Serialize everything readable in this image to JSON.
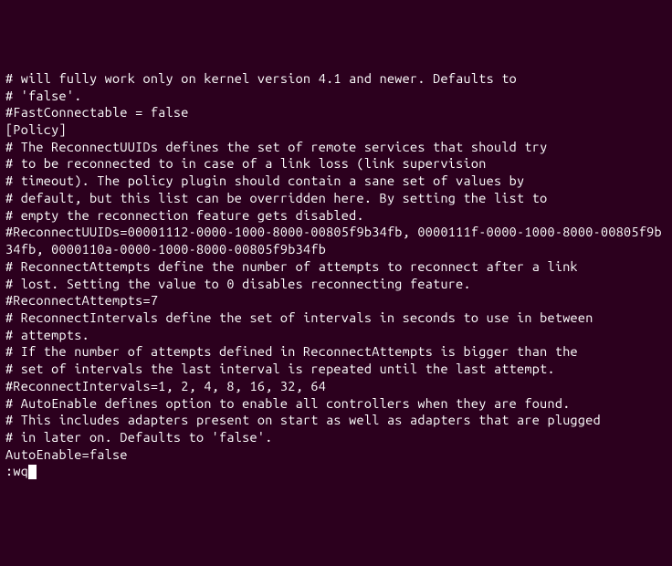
{
  "editor_content": {
    "lines": [
      "# will fully work only on kernel version 4.1 and newer. Defaults to",
      "# 'false'.",
      "#FastConnectable = false",
      "",
      "[Policy]",
      "",
      "# The ReconnectUUIDs defines the set of remote services that should try",
      "# to be reconnected to in case of a link loss (link supervision",
      "# timeout). The policy plugin should contain a sane set of values by",
      "# default, but this list can be overridden here. By setting the list to",
      "# empty the reconnection feature gets disabled.",
      "#ReconnectUUIDs=00001112-0000-1000-8000-00805f9b34fb, 0000111f-0000-1000-8000-00805f9b34fb, 0000110a-0000-1000-8000-00805f9b34fb",
      "",
      "# ReconnectAttempts define the number of attempts to reconnect after a link",
      "# lost. Setting the value to 0 disables reconnecting feature.",
      "#ReconnectAttempts=7",
      "",
      "# ReconnectIntervals define the set of intervals in seconds to use in between",
      "# attempts.",
      "# If the number of attempts defined in ReconnectAttempts is bigger than the",
      "# set of intervals the last interval is repeated until the last attempt.",
      "#ReconnectIntervals=1, 2, 4, 8, 16, 32, 64",
      "",
      "# AutoEnable defines option to enable all controllers when they are found.",
      "# This includes adapters present on start as well as adapters that are plugged",
      "# in later on. Defaults to 'false'.",
      "AutoEnable=false"
    ],
    "command": ":wq"
  }
}
